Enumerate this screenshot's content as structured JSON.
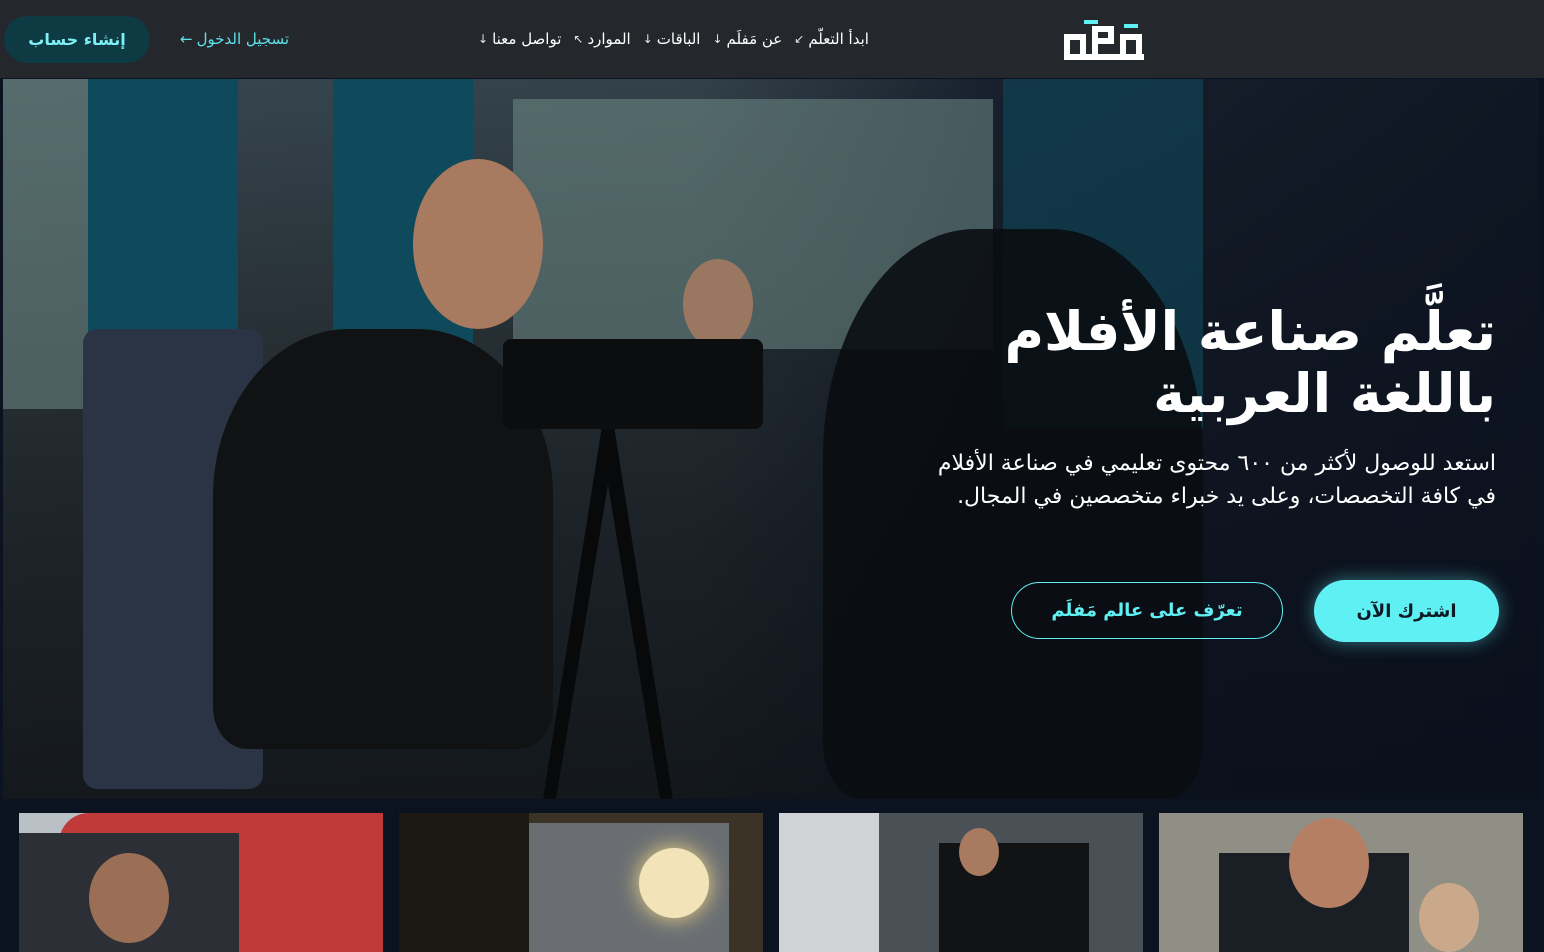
{
  "navbar": {
    "signup_label": "إنشاء حساب",
    "login_label": "تسجيل الدخول",
    "login_arrow": "←",
    "logo_text": "مَفلَم",
    "links": [
      {
        "label": "ابدأ التعلّم",
        "arrow": "↙"
      },
      {
        "label": "عن مَفلَم",
        "arrow": "↓"
      },
      {
        "label": "الباقات",
        "arrow": "↓"
      },
      {
        "label": "الموارد",
        "arrow": "↖"
      },
      {
        "label": "تواصل معنا",
        "arrow": "↓"
      }
    ]
  },
  "hero": {
    "title_line1": "تعلَّم صناعة الأفلام",
    "title_line2": "باللغة العربية",
    "description": "استعد للوصول لأكثر من ٦٠٠ محتوى تعليمي في صناعة الأفلام في كافة التخصصات، وعلى يد خبراء متخصصين في المجال.",
    "primary_cta": "اشترك الآن",
    "secondary_cta": "تعرّف على عالم مَفلَم"
  },
  "colors": {
    "accent": "#5ff0f3",
    "navbar_bg": "#24272c",
    "page_bg": "#0b1220"
  }
}
